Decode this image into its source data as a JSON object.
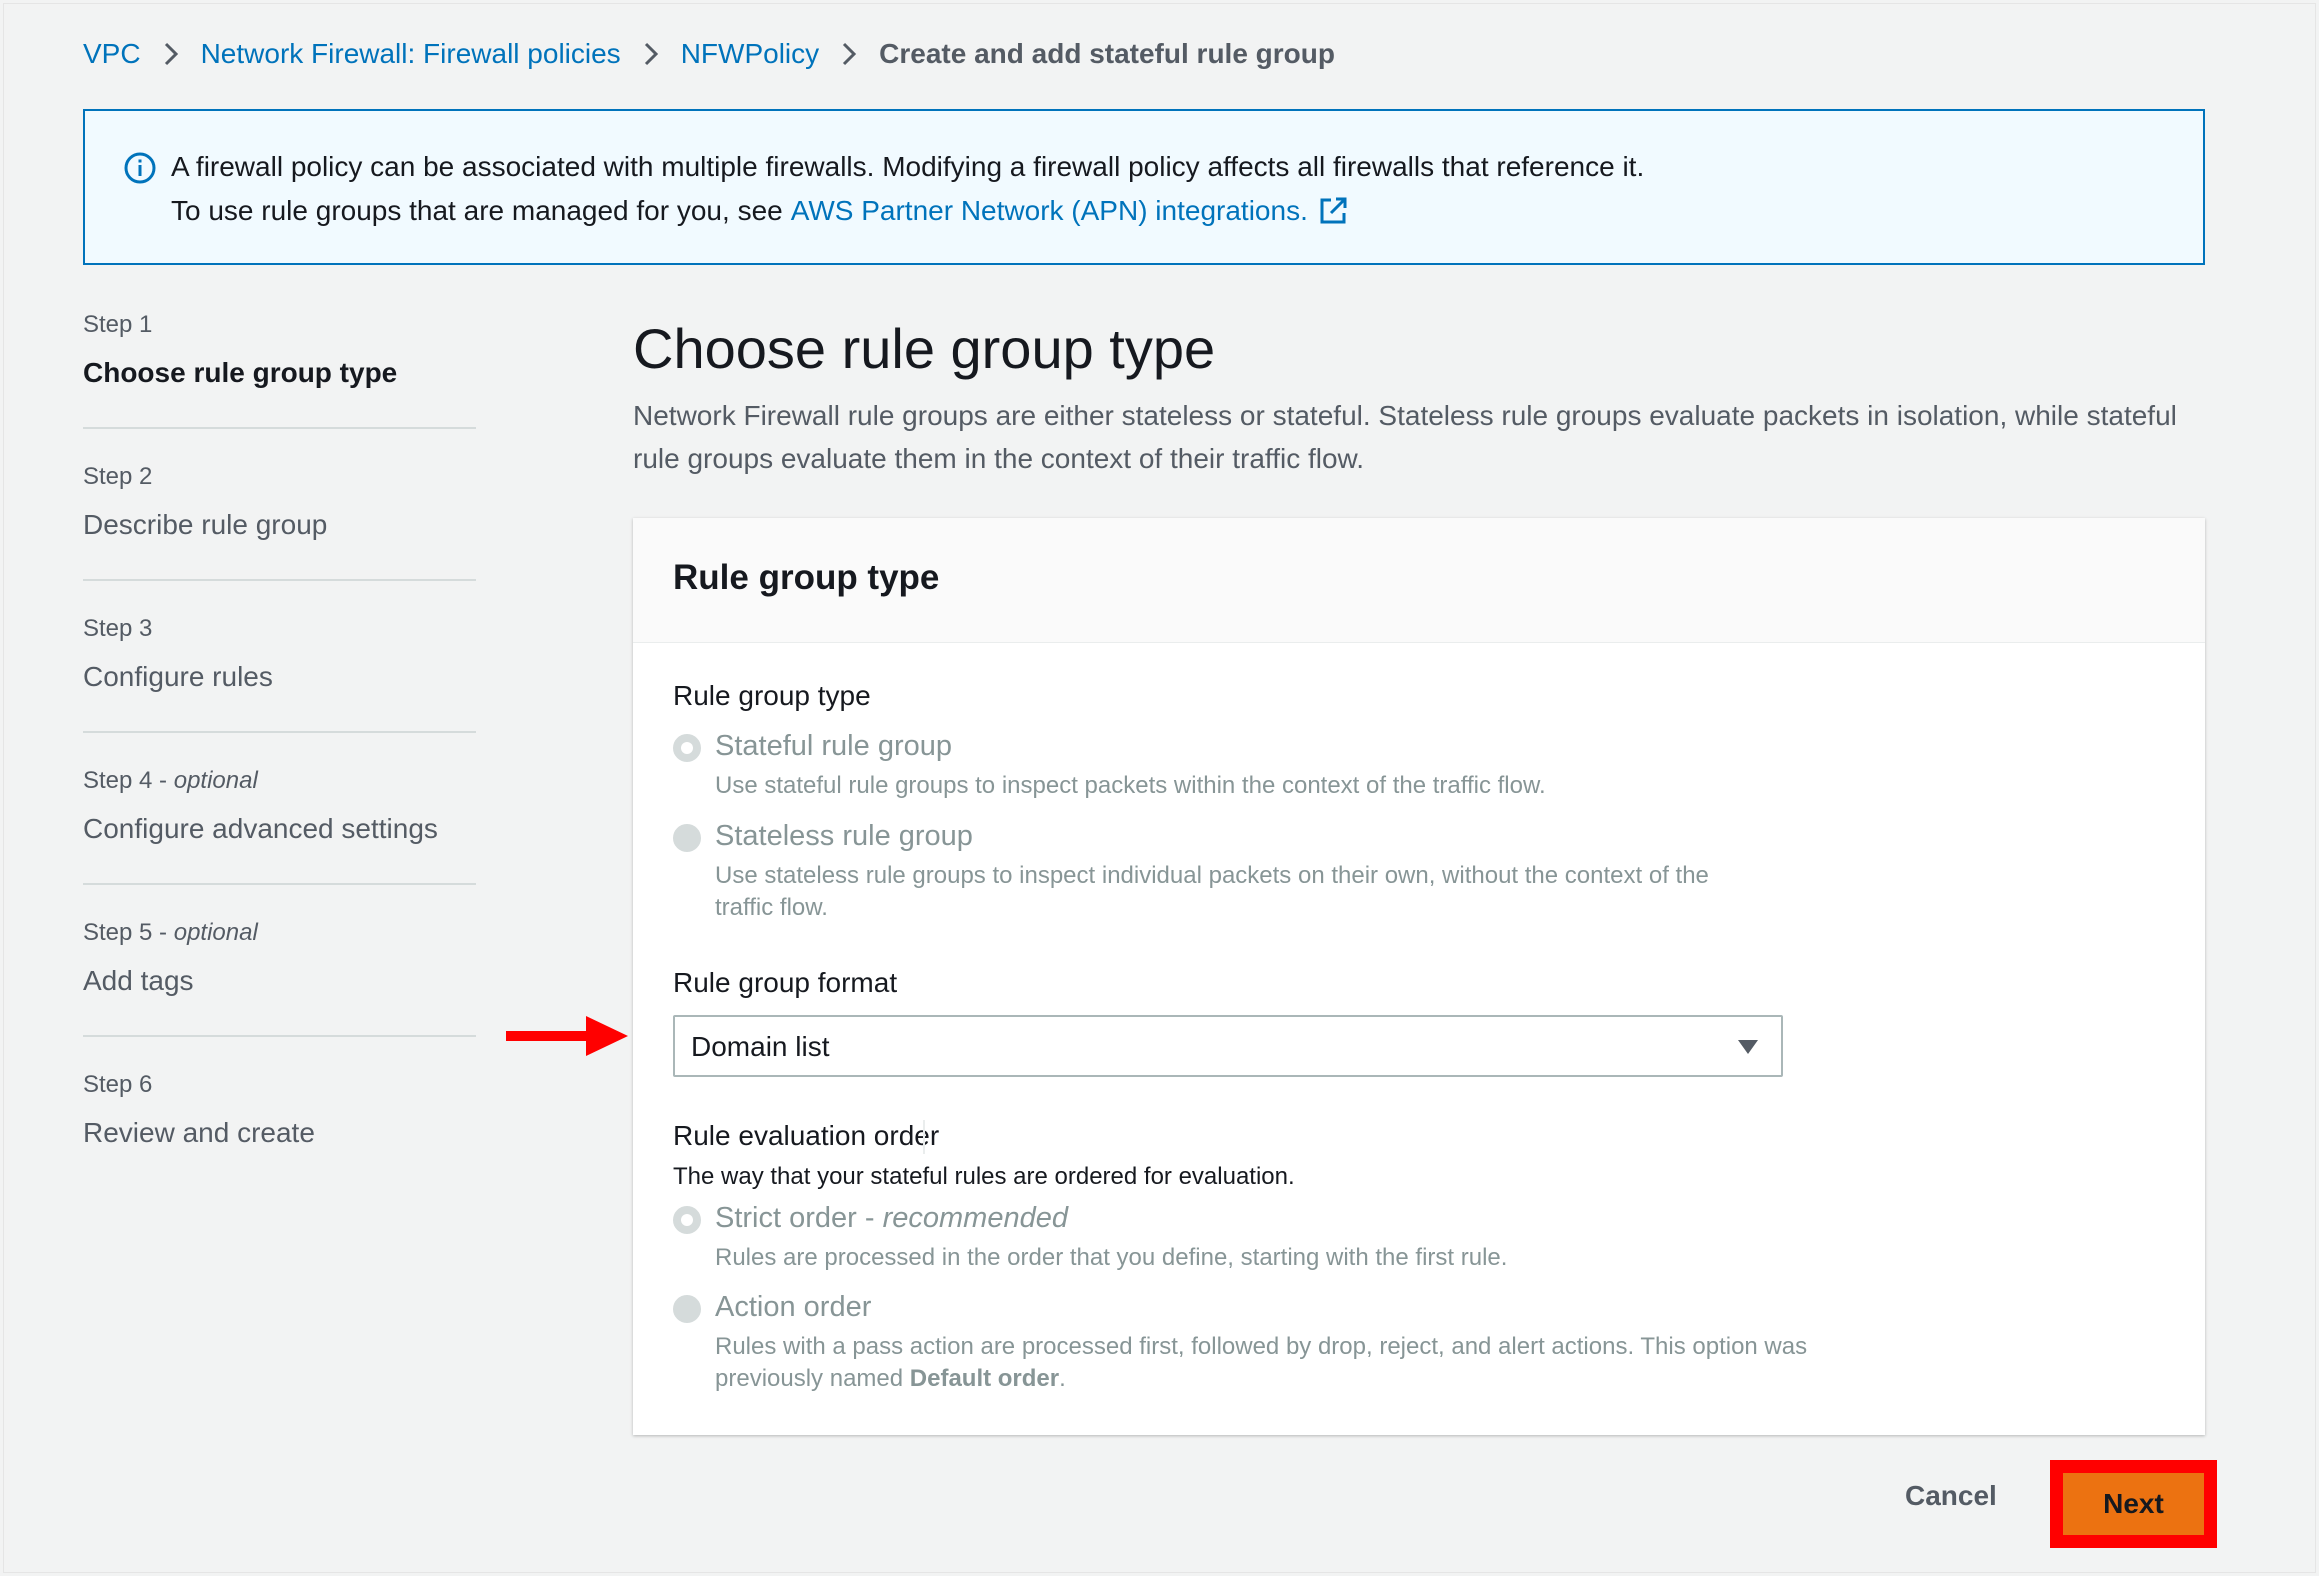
{
  "breadcrumb": {
    "items": [
      "VPC",
      "Network Firewall: Firewall policies",
      "NFWPolicy"
    ],
    "current": "Create and add stateful rule group"
  },
  "banner": {
    "line1": "A firewall policy can be associated with multiple firewalls. Modifying a firewall policy affects all firewalls that reference it.",
    "line2_prefix": "To use rule groups that are managed for you, see",
    "line2_link": "AWS Partner Network (APN) integrations."
  },
  "steps": [
    {
      "num": "Step 1",
      "optional": "",
      "label": "Choose rule group type"
    },
    {
      "num": "Step 2",
      "optional": "",
      "label": "Describe rule group"
    },
    {
      "num": "Step 3",
      "optional": "",
      "label": "Configure rules"
    },
    {
      "num": "Step 4 - ",
      "optional": "optional",
      "label": "Configure advanced settings"
    },
    {
      "num": "Step 5 - ",
      "optional": "optional",
      "label": "Add tags"
    },
    {
      "num": "Step 6",
      "optional": "",
      "label": "Review and create"
    }
  ],
  "main": {
    "title": "Choose rule group type",
    "description": "Network Firewall rule groups are either stateless or stateful. Stateless rule groups evaluate packets in isolation, while stateful rule groups evaluate them in the context of their traffic flow."
  },
  "panel": {
    "title": "Rule group type",
    "type_label": "Rule group type",
    "type_options": [
      {
        "title": "Stateful rule group",
        "desc": "Use stateful rule groups to inspect packets within the context of the traffic flow."
      },
      {
        "title": "Stateless rule group",
        "desc": "Use stateless rule groups to inspect individual packets on their own, without the context of the traffic flow."
      }
    ],
    "format_label": "Rule group format",
    "format_value": "Domain list",
    "order_label": "Rule evaluation order",
    "order_desc": "The way that your stateful rules are ordered for evaluation.",
    "order_options": [
      {
        "title": "Strict order - ",
        "title_em": "recommended",
        "desc": "Rules are processed in the order that you define, starting with the first rule."
      },
      {
        "title": "Action order",
        "title_em": "",
        "desc_prefix": "Rules with a pass action are processed first, followed by drop, reject, and alert actions. This option was previously named ",
        "desc_bold": "Default order",
        "desc_suffix": "."
      }
    ]
  },
  "footer": {
    "cancel": "Cancel",
    "next": "Next"
  },
  "colors": {
    "link": "#0073bb",
    "primary_button": "#ec7211",
    "highlight": "#ff0000"
  }
}
